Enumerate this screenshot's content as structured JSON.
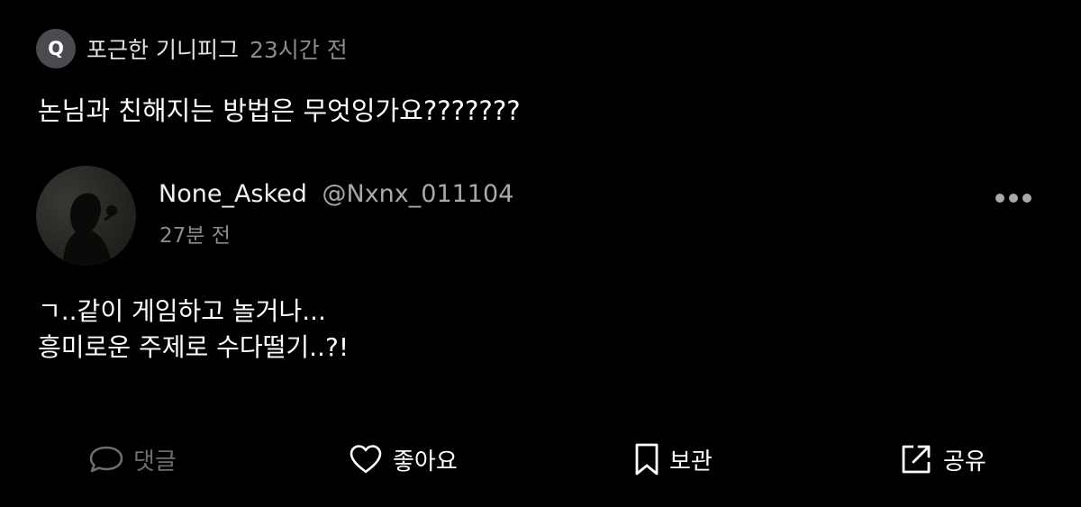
{
  "question": {
    "badge": "Q",
    "asker": "포근한 기니피그",
    "time": "23시간 전",
    "text": "논님과 친해지는 방법은 무엇잉가요???????"
  },
  "answer": {
    "author_name": "None_Asked",
    "author_handle": "@Nxnx_011104",
    "time": "27분 전",
    "lines": [
      "ㄱ..같이 게임하고 놀거나...",
      "흥미로운 주제로 수다떨기..?!"
    ]
  },
  "actions": {
    "comment": "댓글",
    "like": "좋아요",
    "save": "보관",
    "share": "공유"
  },
  "icons": {
    "comment": "chat-bubble-icon",
    "like": "heart-icon",
    "save": "bookmark-icon",
    "share": "share-icon",
    "more": "more-dots-icon"
  },
  "colors": {
    "background": "#000000",
    "badge": "#4b4b4f",
    "muted": "#8b8b8b",
    "disabled": "#6e6e6e"
  }
}
